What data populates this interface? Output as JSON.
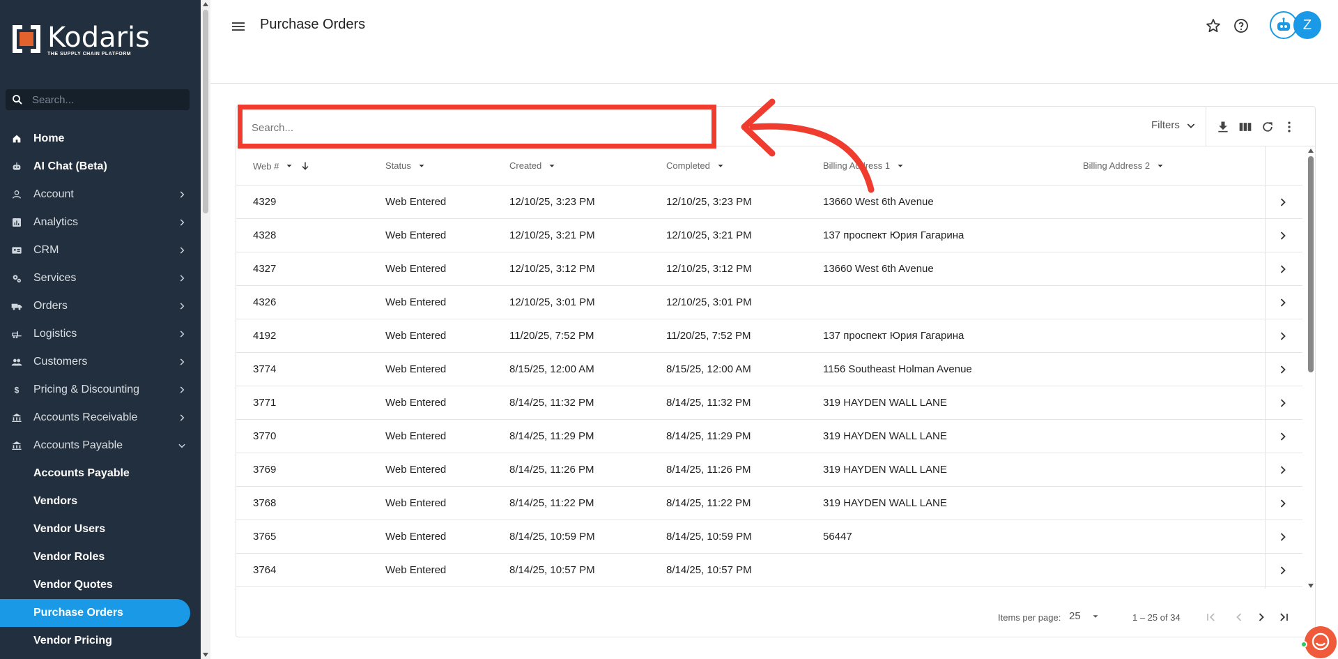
{
  "app": {
    "brand_name": "Kodaris",
    "brand_tagline": "THE SUPPLY CHAIN PLATFORM",
    "brand_color": "#1a9ae6",
    "sidebar_color": "#222f3e"
  },
  "sidebar": {
    "search_placeholder": "Search...",
    "items": [
      {
        "label": "Home",
        "icon": "home-icon"
      },
      {
        "label": "AI Chat (Beta)",
        "icon": "robot-icon"
      },
      {
        "label": "Account",
        "icon": "person-icon"
      },
      {
        "label": "Analytics",
        "icon": "analytics-icon"
      },
      {
        "label": "CRM",
        "icon": "contact-card-icon"
      },
      {
        "label": "Services",
        "icon": "gears-icon"
      },
      {
        "label": "Orders",
        "icon": "truck-icon"
      },
      {
        "label": "Logistics",
        "icon": "forklift-icon"
      },
      {
        "label": "Customers",
        "icon": "people-icon"
      },
      {
        "label": "Pricing & Discounting",
        "icon": "dollar-icon"
      },
      {
        "label": "Accounts Receivable",
        "icon": "bank-icon"
      },
      {
        "label": "Accounts Payable",
        "icon": "bank-icon"
      }
    ],
    "sub_items": [
      {
        "label": "Accounts Payable"
      },
      {
        "label": "Vendors"
      },
      {
        "label": "Vendor Users"
      },
      {
        "label": "Vendor Roles"
      },
      {
        "label": "Vendor Quotes"
      },
      {
        "label": "Purchase Orders",
        "active": true
      },
      {
        "label": "Vendor Pricing"
      }
    ]
  },
  "header": {
    "title": "Purchase Orders",
    "avatar_initial": "Z"
  },
  "table": {
    "search_placeholder": "Search...",
    "filters_label": "Filters",
    "columns": [
      "Web #",
      "Status",
      "Created",
      "Completed",
      "Billing Address 1",
      "Billing Address 2"
    ],
    "rows": [
      {
        "web": "4329",
        "status": "Web Entered",
        "created": "12/10/25, 3:23 PM",
        "completed": "12/10/25, 3:23 PM",
        "billing1": "13660 West 6th Avenue",
        "billing2": ""
      },
      {
        "web": "4328",
        "status": "Web Entered",
        "created": "12/10/25, 3:21 PM",
        "completed": "12/10/25, 3:21 PM",
        "billing1": "137 проспект Юрия Гагарина",
        "billing2": ""
      },
      {
        "web": "4327",
        "status": "Web Entered",
        "created": "12/10/25, 3:12 PM",
        "completed": "12/10/25, 3:12 PM",
        "billing1": "13660 West 6th Avenue",
        "billing2": ""
      },
      {
        "web": "4326",
        "status": "Web Entered",
        "created": "12/10/25, 3:01 PM",
        "completed": "12/10/25, 3:01 PM",
        "billing1": "",
        "billing2": ""
      },
      {
        "web": "4192",
        "status": "Web Entered",
        "created": "11/20/25, 7:52 PM",
        "completed": "11/20/25, 7:52 PM",
        "billing1": "137 проспект Юрия Гагарина",
        "billing2": ""
      },
      {
        "web": "3774",
        "status": "Web Entered",
        "created": "8/15/25, 12:00 AM",
        "completed": "8/15/25, 12:00 AM",
        "billing1": "1156 Southeast Holman Avenue",
        "billing2": ""
      },
      {
        "web": "3771",
        "status": "Web Entered",
        "created": "8/14/25, 11:32 PM",
        "completed": "8/14/25, 11:32 PM",
        "billing1": "319 HAYDEN WALL LANE",
        "billing2": ""
      },
      {
        "web": "3770",
        "status": "Web Entered",
        "created": "8/14/25, 11:29 PM",
        "completed": "8/14/25, 11:29 PM",
        "billing1": "319 HAYDEN WALL LANE",
        "billing2": ""
      },
      {
        "web": "3769",
        "status": "Web Entered",
        "created": "8/14/25, 11:26 PM",
        "completed": "8/14/25, 11:26 PM",
        "billing1": "319 HAYDEN WALL LANE",
        "billing2": ""
      },
      {
        "web": "3768",
        "status": "Web Entered",
        "created": "8/14/25, 11:22 PM",
        "completed": "8/14/25, 11:22 PM",
        "billing1": "319 HAYDEN WALL LANE",
        "billing2": ""
      },
      {
        "web": "3765",
        "status": "Web Entered",
        "created": "8/14/25, 10:59 PM",
        "completed": "8/14/25, 10:59 PM",
        "billing1": "56447",
        "billing2": ""
      },
      {
        "web": "3764",
        "status": "Web Entered",
        "created": "8/14/25, 10:57 PM",
        "completed": "8/14/25, 10:57 PM",
        "billing1": "",
        "billing2": ""
      }
    ]
  },
  "pagination": {
    "items_per_page_label": "Items per page:",
    "items_per_page_value": "25",
    "range_label": "1 – 25 of 34"
  },
  "annotation": {
    "highlight_color": "#f03c2e"
  }
}
